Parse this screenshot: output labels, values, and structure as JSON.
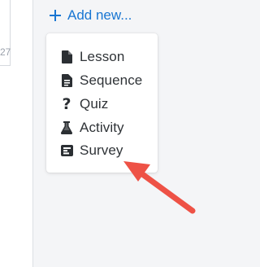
{
  "left_panel": {
    "partial_number": "27"
  },
  "add_new": {
    "label": "Add new...",
    "icon": "plus-icon"
  },
  "menu": {
    "items": [
      {
        "label": "Lesson",
        "icon": "document-icon"
      },
      {
        "label": "Sequence",
        "icon": "list-document-icon"
      },
      {
        "label": "Quiz",
        "icon": "question-mark-icon"
      },
      {
        "label": "Activity",
        "icon": "flask-icon"
      },
      {
        "label": "Survey",
        "icon": "survey-icon"
      }
    ]
  },
  "annotation": {
    "arrow_color": "#ee5246"
  }
}
